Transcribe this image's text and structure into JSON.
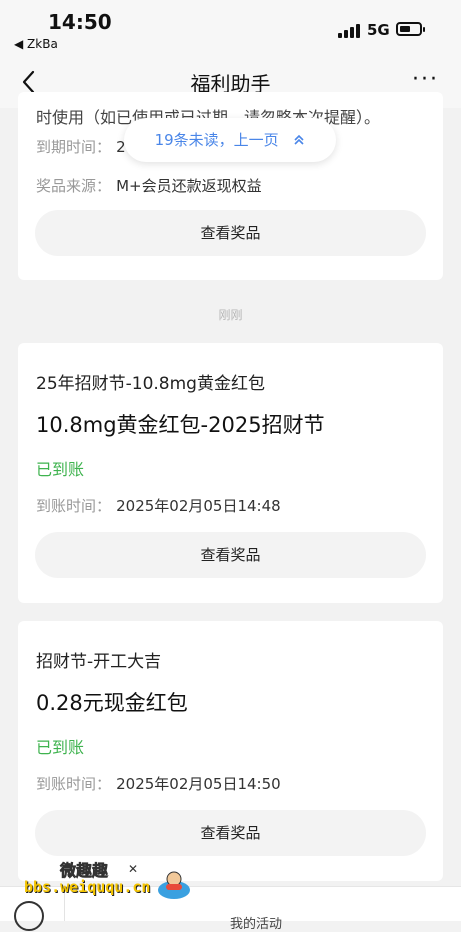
{
  "status_bar": {
    "time": "14:50",
    "back_app": "◀ ZkBa",
    "network": "5G"
  },
  "nav": {
    "title": "福利助手",
    "more": "···"
  },
  "unread_banner": {
    "label": "19条未读，上一页"
  },
  "cards": [
    {
      "cut_text": "时使用（如已使用或已过期，请忽略本次提醒）。",
      "expiry_label": "到期时间：",
      "expiry_value": "2",
      "source_label": "奖品来源：",
      "source_value": "M+会员还款返现权益",
      "button": "查看奖品"
    },
    {
      "title": "25年招财节-10.8mg黄金红包",
      "prize": "10.8mg黄金红包-2025招财节",
      "status": "已到账",
      "time_label": "到账时间：",
      "time_value": "2025年02月05日14:48",
      "button": "查看奖品"
    },
    {
      "title": "招财节-开工大吉",
      "prize": "0.28元现金红包",
      "status": "已到账",
      "time_label": "到账时间：",
      "time_value": "2025年02月05日14:50",
      "button": "查看奖品"
    }
  ],
  "timestamp_label": "刚刚",
  "bottom_bar": {
    "menu_text": "我的活动"
  },
  "watermark": {
    "name": "微趣趣",
    "url": "bbs.weiququ.cn",
    "mark": "✕"
  },
  "colors": {
    "accent_blue": "#4a86e8",
    "status_green": "#3fb34f",
    "background": "#f2f2f2"
  },
  "icons": [
    "back-chevron-icon",
    "more-icon",
    "signal-icon",
    "battery-icon",
    "double-chevron-up-icon"
  ]
}
